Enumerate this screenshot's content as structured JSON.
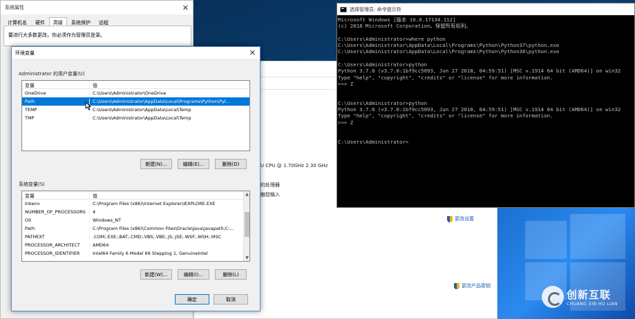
{
  "sysprops": {
    "title": "系统属性",
    "tabs": [
      "计算机名",
      "硬件",
      "高级",
      "系统保护",
      "远程"
    ],
    "active_tab": 2,
    "note": "要进行大多数更改，你必须作为管理员登录。"
  },
  "sysinfo": {
    "cpu": "U CPU @ 1.70GHz   2.30 GHz",
    "processor_text": "的处理器",
    "input_text": "触控输入",
    "change_settings": "更改设置",
    "change_product_key": "更改产品密钥"
  },
  "envdlg": {
    "title": "环境变量",
    "user_section": "Administrator 的用户变量(U)",
    "user_header": [
      "变量",
      "值"
    ],
    "user_rows": [
      [
        "OneDrive",
        "C:\\Users\\Administrator\\OneDrive"
      ],
      [
        "Path",
        "C:\\Users\\Administrator\\AppData\\Local\\Programs\\Python\\Pyt..."
      ],
      [
        "TEMP",
        "C:\\Users\\Administrator\\AppData\\Local\\Temp"
      ],
      [
        "TMP",
        "C:\\Users\\Administrator\\AppData\\Local\\Temp"
      ]
    ],
    "user_selected": 1,
    "user_buttons": [
      "新建(N)...",
      "编辑(E)...",
      "删除(D)"
    ],
    "sys_section": "系统变量(S)",
    "sys_header": [
      "变量",
      "值"
    ],
    "sys_rows": [
      [
        "Inkenv",
        "C:\\Program Files (x86)\\Internet Explorer\\IEXPLORE.EXE"
      ],
      [
        "NUMBER_OF_PROCESSORS",
        "4"
      ],
      [
        "OS",
        "Windows_NT"
      ],
      [
        "Path",
        "C:\\Program Files (x86)\\Common Files\\Oracle\\Java\\javapath;C:..."
      ],
      [
        "PATHEXT",
        ".COM;.EXE;.BAT;.CMD;.VBS;.VBE;.JS;.JSE;.WSF;.WSH;.MSC"
      ],
      [
        "PROCESSOR_ARCHITECT",
        "AMD64"
      ],
      [
        "PROCESSOR_IDENTIFIER",
        "Intel64 Family 6 Model 69 Stepping 1, GenuineIntel"
      ]
    ],
    "sys_buttons": [
      "新建(W)...",
      "编辑(I)...",
      "删除(L)"
    ],
    "ok": "确定",
    "cancel": "取消"
  },
  "cmd": {
    "title": "选择管理员: 命令提示符",
    "lines": [
      "Microsoft Windows [版本 10.0.17134.112]",
      "(c) 2018 Microsoft Corporation。保留所有权利。",
      "",
      "C:\\Users\\Administrator>where python",
      "C:\\Users\\Administrator\\AppData\\Local\\Programs\\Python\\Python37\\python.exe",
      "C:\\Users\\Administrator\\AppData\\Local\\Programs\\Python\\Python36\\python.exe",
      "",
      "C:\\Users\\Administrator>python",
      "Python 3.7.0 (v3.7.0:1bf9cc5093, Jun 27 2018, 04:59:51) [MSC v.1914 64 bit (AMD64)] on win32",
      "Type \"help\", \"copyright\", \"credits\" or \"license\" for more information.",
      ">>> Z",
      "",
      "",
      "C:\\Users\\Administrator>python",
      "Python 3.7.0 (v3.7.0:1bf9cc5093, Jun 27 2018, 04:59:51) [MSC v.1914 64 bit (AMD64)] on win32",
      "Type \"help\", \"copyright\", \"credits\" or \"license\" for more information.",
      ">>> Z",
      "",
      "",
      "C:\\Users\\Administrator>"
    ]
  },
  "watermark": {
    "cn": "创新互联",
    "en": "CHUANG XIN HU LIAN"
  }
}
